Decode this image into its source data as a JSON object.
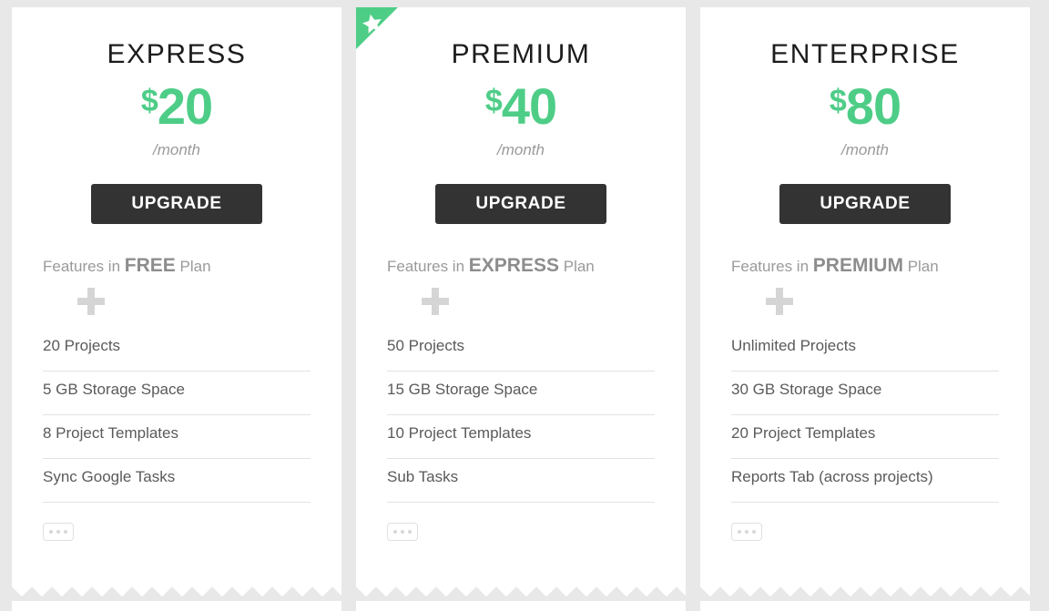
{
  "accent_color": "#4ecd87",
  "button_color": "#333333",
  "page_background": "#e8e8e8",
  "plans": [
    {
      "name": "EXPRESS",
      "currency": "$",
      "amount": "20",
      "period": "/month",
      "cta_label": "UPGRADE",
      "featured": false,
      "features_head_prefix": "Features in",
      "features_head_plan": "FREE",
      "features_head_suffix": "Plan",
      "plus_icon": "plus-icon",
      "features": [
        "20 Projects",
        "5 GB Storage Space",
        "8 Project Templates",
        "Sync Google Tasks"
      ],
      "more_label": "..."
    },
    {
      "name": "PREMIUM",
      "currency": "$",
      "amount": "40",
      "period": "/month",
      "cta_label": "UPGRADE",
      "featured": true,
      "badge_icon": "star-icon",
      "features_head_prefix": "Features in",
      "features_head_plan": "EXPRESS",
      "features_head_suffix": "Plan",
      "plus_icon": "plus-icon",
      "features": [
        "50 Projects",
        "15 GB Storage Space",
        "10 Project Templates",
        "Sub Tasks"
      ],
      "more_label": "..."
    },
    {
      "name": "ENTERPRISE",
      "currency": "$",
      "amount": "80",
      "period": "/month",
      "cta_label": "UPGRADE",
      "featured": false,
      "features_head_prefix": "Features in",
      "features_head_plan": "PREMIUM",
      "features_head_suffix": "Plan",
      "plus_icon": "plus-icon",
      "features": [
        "Unlimited Projects",
        "30 GB Storage Space",
        "20 Project Templates",
        "Reports Tab (across projects)"
      ],
      "more_label": "..."
    }
  ]
}
